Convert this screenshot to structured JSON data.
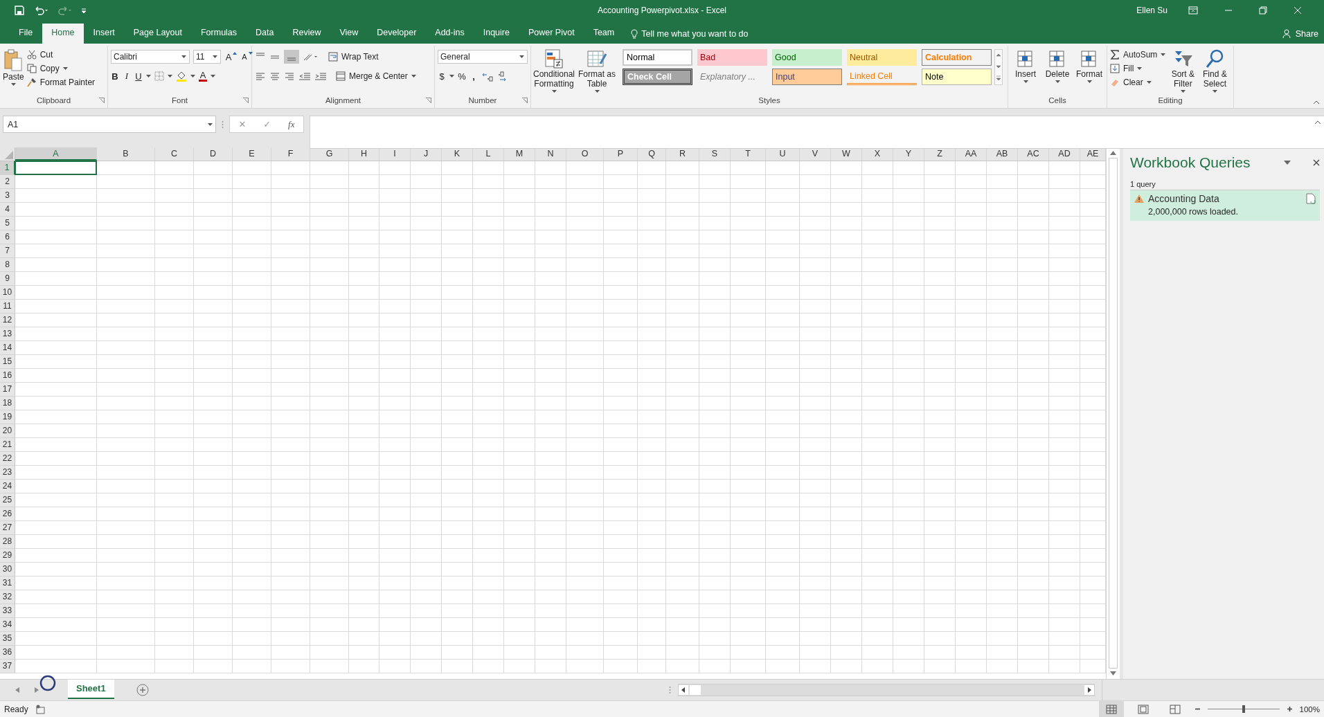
{
  "title_bar": {
    "title": "Accounting Powerpivot.xlsx  -  Excel",
    "user": "Ellen Su"
  },
  "ribbon_tabs": [
    {
      "label": "File",
      "selected": false
    },
    {
      "label": "Home",
      "selected": true
    },
    {
      "label": "Insert",
      "selected": false
    },
    {
      "label": "Page Layout",
      "selected": false
    },
    {
      "label": "Formulas",
      "selected": false
    },
    {
      "label": "Data",
      "selected": false
    },
    {
      "label": "Review",
      "selected": false
    },
    {
      "label": "View",
      "selected": false
    },
    {
      "label": "Developer",
      "selected": false
    },
    {
      "label": "Add-ins",
      "selected": false
    },
    {
      "label": "Inquire",
      "selected": false
    },
    {
      "label": "Power Pivot",
      "selected": false
    },
    {
      "label": "Team",
      "selected": false
    }
  ],
  "tell_me": {
    "placeholder": "Tell me what you want to do"
  },
  "share": "Share",
  "clipboard": {
    "paste": "Paste",
    "cut": "Cut",
    "copy": "Copy",
    "format_painter": "Format Painter",
    "label": "Clipboard"
  },
  "font": {
    "name": "Calibri",
    "size": "11",
    "grow": "A",
    "shrink": "A",
    "bold": "B",
    "italic": "I",
    "underline": "U",
    "font_color_letter": "A",
    "label": "Font"
  },
  "alignment": {
    "wrap_text": "Wrap Text",
    "merge": "Merge & Center",
    "label": "Alignment"
  },
  "number": {
    "format": "General",
    "currency": "$",
    "percent": "%",
    "comma": ",",
    "label": "Number"
  },
  "styles": {
    "conditional": "Conditional Formatting",
    "format_table": "Format as Table",
    "label": "Styles",
    "gallery": [
      {
        "label": "Normal",
        "kind": "normal"
      },
      {
        "label": "Bad",
        "kind": "bad"
      },
      {
        "label": "Good",
        "kind": "good"
      },
      {
        "label": "Neutral",
        "kind": "neutral"
      },
      {
        "label": "Calculation",
        "kind": "calculation"
      },
      {
        "label": "Check Cell",
        "kind": "check"
      },
      {
        "label": "Explanatory ...",
        "kind": "explanatory"
      },
      {
        "label": "Input",
        "kind": "input"
      },
      {
        "label": "Linked Cell",
        "kind": "linked"
      },
      {
        "label": "Note",
        "kind": "note"
      }
    ]
  },
  "cells_group": {
    "buttons": [
      "Insert",
      "Delete",
      "Format"
    ],
    "label": "Cells"
  },
  "editing": {
    "autosum": "AutoSum",
    "fill": "Fill",
    "clear": "Clear",
    "sort": "Sort & Filter",
    "find": "Find & Select",
    "label": "Editing"
  },
  "formula_bar": {
    "name_box": "A1",
    "cancel": "✕",
    "enter": "✓",
    "function_label": "fx"
  },
  "grid": {
    "columns": [
      {
        "label": "A",
        "selected": true
      },
      {
        "label": "B",
        "selected": false
      },
      {
        "label": "C",
        "selected": false
      },
      {
        "label": "D",
        "selected": false
      },
      {
        "label": "E",
        "selected": false
      },
      {
        "label": "F",
        "selected": false
      },
      {
        "label": "G",
        "selected": false
      },
      {
        "label": "H",
        "selected": false
      },
      {
        "label": "I",
        "selected": false
      },
      {
        "label": "J",
        "selected": false
      },
      {
        "label": "K",
        "selected": false
      },
      {
        "label": "L",
        "selected": false
      },
      {
        "label": "M",
        "selected": false
      },
      {
        "label": "N",
        "selected": false
      },
      {
        "label": "O",
        "selected": false
      },
      {
        "label": "P",
        "selected": false
      },
      {
        "label": "Q",
        "selected": false
      },
      {
        "label": "R",
        "selected": false
      },
      {
        "label": "S",
        "selected": false
      },
      {
        "label": "T",
        "selected": false
      },
      {
        "label": "U",
        "selected": false
      },
      {
        "label": "V",
        "selected": false
      },
      {
        "label": "W",
        "selected": false
      },
      {
        "label": "X",
        "selected": false
      },
      {
        "label": "Y",
        "selected": false
      },
      {
        "label": "Z",
        "selected": false
      },
      {
        "label": "AA",
        "selected": false
      },
      {
        "label": "AB",
        "selected": false
      },
      {
        "label": "AC",
        "selected": false
      },
      {
        "label": "AD",
        "selected": false
      },
      {
        "label": "AE",
        "selected": false
      }
    ],
    "rows": [
      {
        "label": "1",
        "selected": true
      },
      {
        "label": "2",
        "selected": false
      },
      {
        "label": "3",
        "selected": false
      },
      {
        "label": "4",
        "selected": false
      },
      {
        "label": "5",
        "selected": false
      },
      {
        "label": "6",
        "selected": false
      },
      {
        "label": "7",
        "selected": false
      },
      {
        "label": "8",
        "selected": false
      },
      {
        "label": "9",
        "selected": false
      },
      {
        "label": "10",
        "selected": false
      },
      {
        "label": "11",
        "selected": false
      },
      {
        "label": "12",
        "selected": false
      },
      {
        "label": "13",
        "selected": false
      },
      {
        "label": "14",
        "selected": false
      },
      {
        "label": "15",
        "selected": false
      },
      {
        "label": "16",
        "selected": false
      },
      {
        "label": "17",
        "selected": false
      },
      {
        "label": "18",
        "selected": false
      },
      {
        "label": "19",
        "selected": false
      },
      {
        "label": "20",
        "selected": false
      },
      {
        "label": "21",
        "selected": false
      },
      {
        "label": "22",
        "selected": false
      },
      {
        "label": "23",
        "selected": false
      },
      {
        "label": "24",
        "selected": false
      },
      {
        "label": "25",
        "selected": false
      },
      {
        "label": "26",
        "selected": false
      },
      {
        "label": "27",
        "selected": false
      },
      {
        "label": "28",
        "selected": false
      },
      {
        "label": "29",
        "selected": false
      },
      {
        "label": "30",
        "selected": false
      },
      {
        "label": "31",
        "selected": false
      },
      {
        "label": "32",
        "selected": false
      },
      {
        "label": "33",
        "selected": false
      },
      {
        "label": "34",
        "selected": false
      },
      {
        "label": "35",
        "selected": false
      },
      {
        "label": "36",
        "selected": false
      },
      {
        "label": "37",
        "selected": false
      }
    ]
  },
  "sheet_tabs": [
    {
      "label": "Sheet1",
      "selected": true
    }
  ],
  "status": "Ready",
  "zoom": "100%",
  "zoom_slider": {
    "level": 0.5
  },
  "queries_pane": {
    "title": "Workbook Queries",
    "count": "1 query",
    "queries": [
      {
        "name": "Accounting Data",
        "status": "2,000,000 rows loaded.",
        "warning": true
      }
    ]
  }
}
